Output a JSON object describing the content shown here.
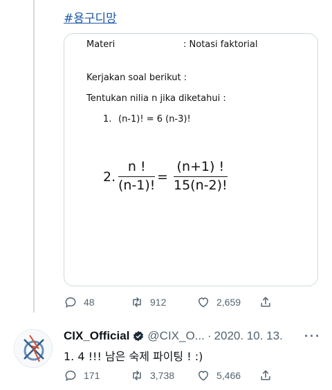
{
  "hashtag": "#용구디망",
  "doc": {
    "materi_label": "Materi",
    "materi_value": ": Notasi faktorial",
    "instruction": "Kerjakan soal berikut :",
    "question": "Tentukan nilia n jika diketahui :",
    "item1_num": "1.",
    "item1_expr": "(n-1)! = 6 (n-3)!",
    "item2_num": "2.",
    "left_num": "n !",
    "left_den": "(n-1)!",
    "equals": "=",
    "right_num": "(n+1) !",
    "right_den": "15(n-2)!"
  },
  "tweet1_actions": {
    "replies": "48",
    "retweets": "912",
    "likes": "2,659"
  },
  "tweet2": {
    "name": "CIX_Official",
    "handle": "@CIX_O...",
    "separator": "·",
    "date": "2020. 10. 13.",
    "more": "···",
    "text": "1. 4 !!! 남은 숙제 파이팅 ! :)",
    "replies": "171",
    "retweets": "3,738",
    "likes": "5,466"
  },
  "colors": {
    "link": "#1d58a8",
    "muted": "#536471",
    "verified": "#1d2a3a"
  }
}
